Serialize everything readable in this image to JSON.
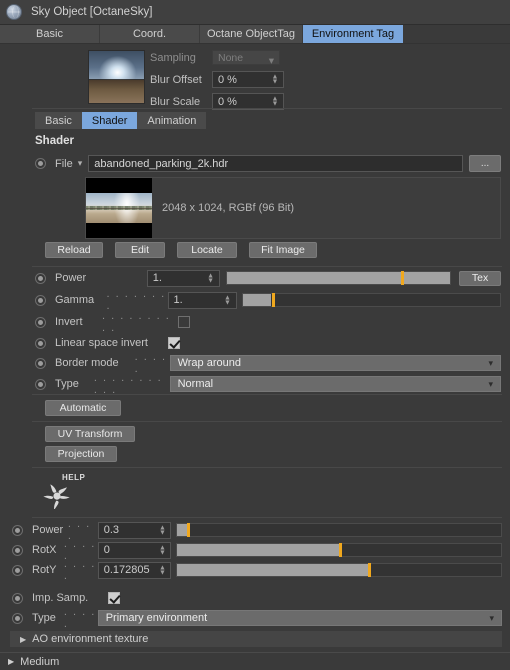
{
  "window": {
    "title": "Sky Object [OctaneSky]",
    "icon": "sky-sphere-icon"
  },
  "top_tabs": [
    {
      "label": "Basic",
      "selected": false
    },
    {
      "label": "Coord.",
      "selected": false
    },
    {
      "label": "Octane ObjectTag",
      "selected": false
    },
    {
      "label": "Environment Tag",
      "selected": true
    }
  ],
  "sky_block": {
    "rows": [
      {
        "label": "Sampling",
        "type": "combo",
        "value": "None",
        "disabled": true
      },
      {
        "label": "Blur Offset",
        "type": "number",
        "value": "0 %"
      },
      {
        "label": "Blur Scale",
        "type": "number",
        "value": "0 %"
      }
    ]
  },
  "sub_tabs": [
    {
      "label": "Basic",
      "selected": false
    },
    {
      "label": "Shader",
      "selected": true
    },
    {
      "label": "Animation",
      "selected": false
    }
  ],
  "shader": {
    "heading": "Shader",
    "file_label": "File",
    "file_value": "abandoned_parking_2k.hdr",
    "browse_label": "...",
    "preview_info": "2048 x 1024, RGBf (96 Bit)",
    "buttons": [
      "Reload",
      "Edit",
      "Locate",
      "Fit Image"
    ]
  },
  "shader_params": {
    "power": {
      "label": "Power",
      "value": "1.",
      "slider_fill_pct": 100,
      "marker_pct": 78,
      "tex_label": "Tex"
    },
    "gamma": {
      "label": "Gamma",
      "dots": ". . . . . . . .",
      "value": "1.",
      "slider_fill_pct": 11,
      "marker_pct": 11.5
    },
    "invert": {
      "label": "Invert",
      "dots": ". . . . . . . . . .",
      "checked": false
    },
    "linear_space_invert": {
      "label": "Linear space invert",
      "checked": true
    },
    "border_mode": {
      "label": "Border mode",
      "dots": ". . . . .",
      "value": "Wrap around"
    },
    "type": {
      "label": "Type",
      "dots": ". . . . . . . . . . .",
      "value": "Normal"
    }
  },
  "transform_buttons": {
    "automatic": "Automatic",
    "uv_transform": "UV Transform",
    "projection": "Projection"
  },
  "octane_help": {
    "label": "HELP",
    "icon": "octane-fan-logo-icon"
  },
  "env_params": {
    "power": {
      "label": "Power",
      "dots": ". . . .",
      "value": "0.3",
      "slider_fill_pct": 3,
      "marker_pct": 3
    },
    "rotx": {
      "label": "RotX",
      "dots": ". . . . .",
      "value": "0",
      "slider_fill_pct": 50,
      "marker_pct": 50
    },
    "roty": {
      "label": "RotY",
      "dots": ". . . . .",
      "value": "0.172805",
      "slider_fill_pct": 59,
      "marker_pct": 59
    },
    "imp_samp": {
      "label": "Imp. Samp.",
      "checked": true
    },
    "type": {
      "label": "Type",
      "dots": ". . . . .",
      "value": "Primary environment"
    }
  },
  "groups": {
    "ao_environment_texture": "AO environment texture",
    "medium": "Medium"
  },
  "colors": {
    "accent_blue": "#7ba7dd",
    "slider_marker": "#f0a81e",
    "panel_bg": "#3a3a3a",
    "button_bg": "#6b6b6b"
  }
}
